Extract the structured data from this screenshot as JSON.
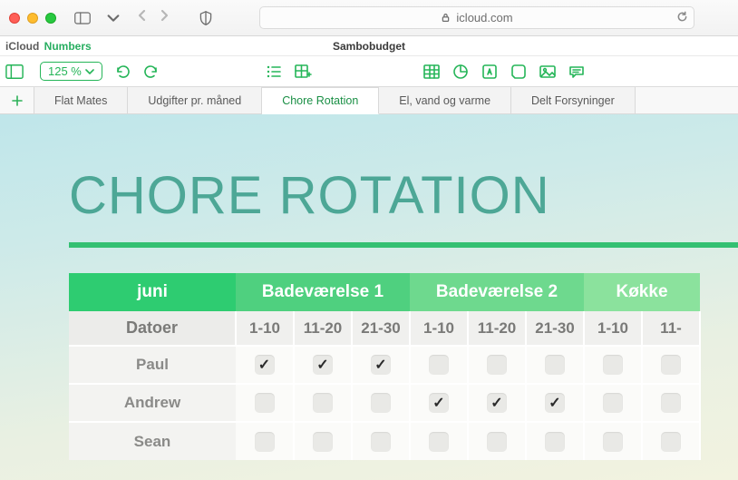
{
  "browser": {
    "domain": "icloud.com"
  },
  "subheader": {
    "brand_icloud": "iCloud",
    "brand_app": "Numbers",
    "doc_title": "Sambobudget"
  },
  "toolbar": {
    "zoom_label": "125 %"
  },
  "tabs": [
    {
      "label": "Flat Mates",
      "active": false
    },
    {
      "label": "Udgifter pr. måned",
      "active": false
    },
    {
      "label": "Chore Rotation",
      "active": true
    },
    {
      "label": "El, vand og varme",
      "active": false
    },
    {
      "label": "Delt Forsyninger",
      "active": false
    }
  ],
  "sheet": {
    "title": "Chore Rotation",
    "month": "juni",
    "groups": [
      "Badeværelse 1",
      "Badeværelse 2",
      "Køkke"
    ],
    "date_label": "Datoer",
    "dates": [
      "1-10",
      "11-20",
      "21-30",
      "1-10",
      "11-20",
      "21-30",
      "1-10",
      "11-"
    ],
    "rows": [
      {
        "name": "Paul",
        "checks": [
          true,
          true,
          true,
          false,
          false,
          false,
          false,
          false
        ]
      },
      {
        "name": "Andrew",
        "checks": [
          false,
          false,
          false,
          true,
          true,
          true,
          false,
          false
        ]
      },
      {
        "name": "Sean",
        "checks": [
          false,
          false,
          false,
          false,
          false,
          false,
          false,
          false
        ]
      }
    ]
  }
}
